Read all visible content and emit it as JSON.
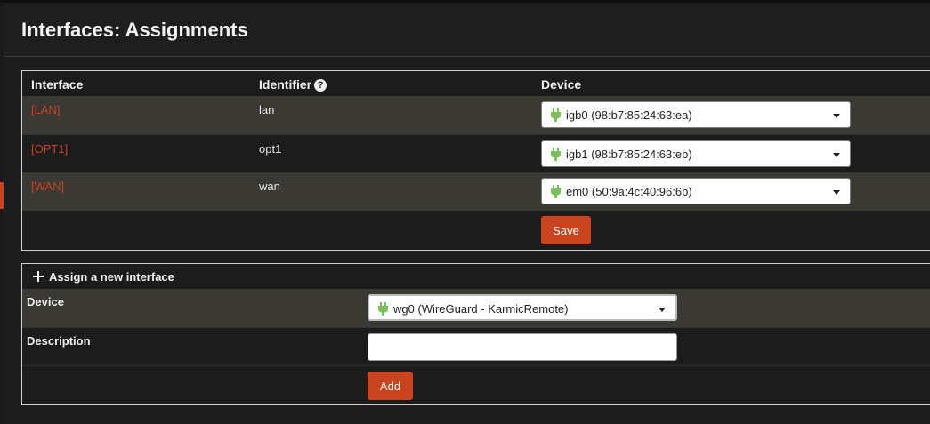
{
  "page": {
    "title": "Interfaces: Assignments"
  },
  "assignments": {
    "columns": {
      "interface": "Interface",
      "identifier": "Identifier",
      "device": "Device"
    },
    "rows": [
      {
        "interface": "[LAN]",
        "identifier": "lan",
        "device": "igb0 (98:b7:85:24:63:ea)"
      },
      {
        "interface": "[OPT1]",
        "identifier": "opt1",
        "device": "igb1 (98:b7:85:24:63:eb)"
      },
      {
        "interface": "[WAN]",
        "identifier": "wan",
        "device": "em0 (50:9a:4c:40:96:6b)"
      }
    ],
    "save_label": "Save"
  },
  "new_interface": {
    "heading": "Assign a new interface",
    "device_label": "Device",
    "device_value": "wg0 (WireGuard - KarmicRemote)",
    "description_label": "Description",
    "description_value": "",
    "add_label": "Add"
  },
  "colors": {
    "accent": "#c8431e",
    "row_dark": "#3a3934",
    "plug_icon": "#7cc05a"
  }
}
